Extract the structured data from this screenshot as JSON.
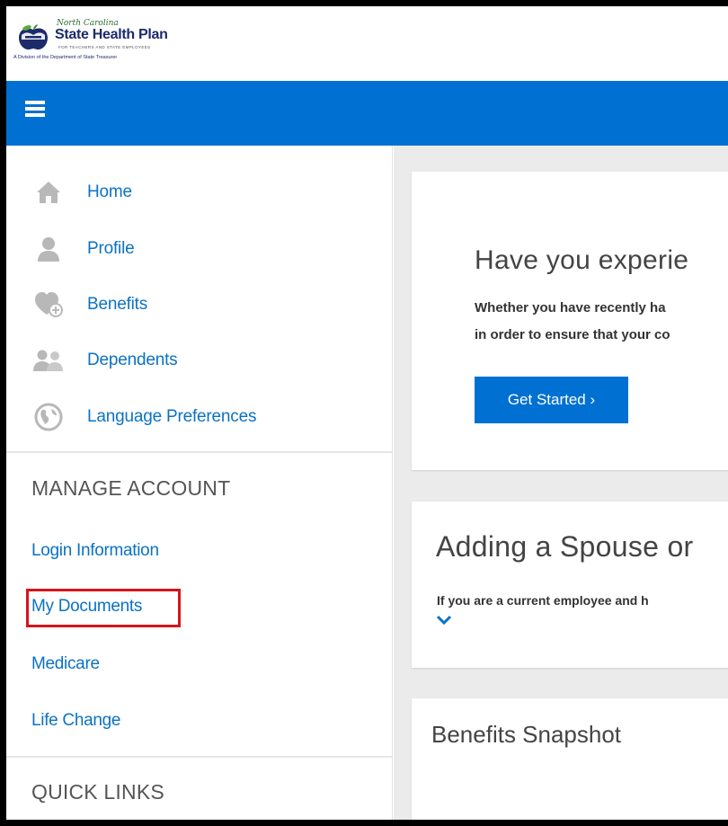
{
  "header": {
    "logo": {
      "script_text": "North Carolina",
      "title": "State Health Plan",
      "tagline": "FOR TEACHERS AND STATE EMPLOYEES",
      "division": "A Division of the Department of State Treasurer"
    },
    "brand_color": "#0070d2"
  },
  "sidebar": {
    "nav": [
      {
        "label": "Home",
        "icon": "home-icon"
      },
      {
        "label": "Profile",
        "icon": "person-icon"
      },
      {
        "label": "Benefits",
        "icon": "heart-plus-icon"
      },
      {
        "label": "Dependents",
        "icon": "people-icon"
      },
      {
        "label": "Language Preferences",
        "icon": "globe-icon"
      }
    ],
    "manage_account": {
      "heading": "MANAGE ACCOUNT",
      "links": [
        {
          "label": "Login Information"
        },
        {
          "label": "My Documents",
          "highlighted": true
        },
        {
          "label": "Medicare"
        },
        {
          "label": "Life Change"
        }
      ]
    },
    "quick_links": {
      "heading": "QUICK LINKS"
    }
  },
  "main": {
    "card1": {
      "title": "Have you experie",
      "line1": "Whether you have recently ha",
      "line2": "in order to ensure that your co",
      "button": "Get Started ›"
    },
    "card2": {
      "title": "Adding a Spouse or",
      "text": "If you are a current employee and h"
    },
    "card3": {
      "title": "Benefits Snapshot"
    }
  },
  "highlight_color": "#d4151b"
}
